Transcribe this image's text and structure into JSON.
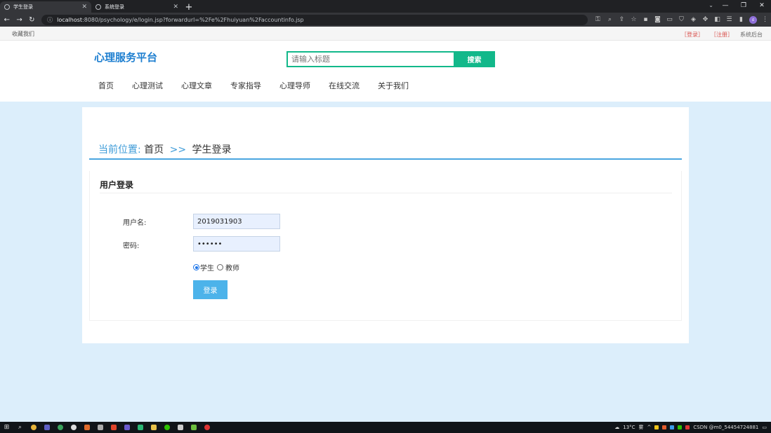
{
  "browser": {
    "tabs": [
      {
        "title": "学生登录",
        "active": true
      },
      {
        "title": "系统登录",
        "active": false
      }
    ],
    "new_tab": "+",
    "url_host": "localhost",
    "url_rest": ":8080/psychology/e/login.jsp?forwardurl=%2Fe%2Fhuiyuan%2Faccountinfo.jsp",
    "profile_initial": "s"
  },
  "topbar": {
    "favorite": "收藏我们",
    "login": "［登录］",
    "register": "［注册］",
    "admin": "系统后台"
  },
  "header": {
    "logo": "心理服务平台",
    "search_placeholder": "请输入标题",
    "search_button": "搜索"
  },
  "nav": {
    "items": [
      "首页",
      "心理测试",
      "心理文章",
      "专家指导",
      "心理导师",
      "在线交流",
      "关于我们"
    ]
  },
  "breadcrumb": {
    "prefix": "当前位置:",
    "home": "首页",
    "separator": ">>",
    "current": "学生登录"
  },
  "login": {
    "title": "用户登录",
    "username_label": "用户名:",
    "username_value": "2019031903",
    "password_label": "密码:",
    "password_value": "••••••",
    "role_student": "学生",
    "role_teacher": "教师",
    "selected_role": "学生",
    "submit": "登录"
  },
  "taskbar": {
    "weather_temp": "13°C",
    "weather_cond": "雾",
    "tray_text": "CSDN @m0_54454724881"
  },
  "colors": {
    "accent_green": "#12b88a",
    "logo_blue": "#1e7fd0",
    "button_blue": "#4cb3ea",
    "page_bg": "#dceefb"
  }
}
